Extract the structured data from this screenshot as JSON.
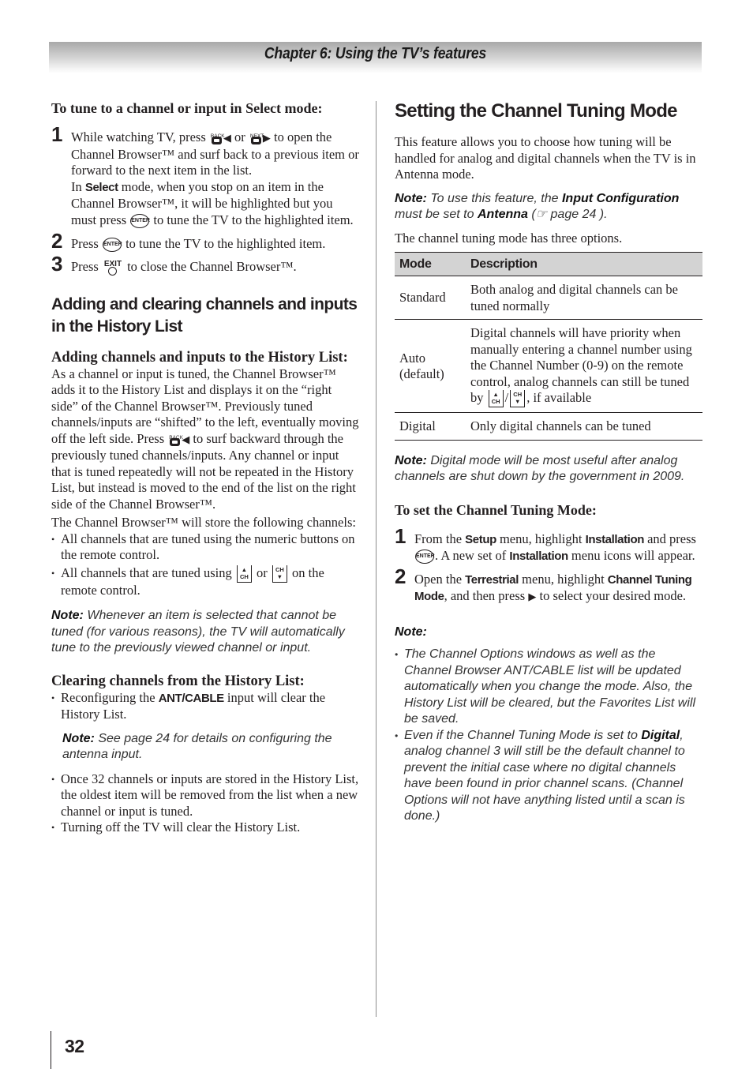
{
  "header": {
    "chapter_title": "Chapter 6: Using the TV’s features"
  },
  "page_number": "32",
  "left": {
    "select_mode": {
      "heading": "To tune to a channel or input in Select mode:",
      "step1": {
        "num": "1",
        "t1": "While watching TV, press",
        "back_label": "BACK",
        "t2": "or",
        "next_label": "NEXT",
        "t3": "to open the Channel Browser™ and surf back to a previous item or forward to the next item in the list.",
        "t4": "In",
        "kw_select": "Select",
        "t5": "mode, when you stop on an item in the Channel Browser™, it will be highlighted but you must press",
        "t6": "to tune the TV to the highlighted item."
      },
      "step2": {
        "num": "2",
        "t1": "Press",
        "t2": "to tune the TV to the highlighted item."
      },
      "step3": {
        "num": "3",
        "t1": "Press",
        "exit_label": "EXIT",
        "t2": "to close the Channel Browser™."
      }
    },
    "history": {
      "heading": "Adding and clearing channels and inputs in the History List",
      "adding_heading": "Adding channels and inputs to the History List:",
      "adding_p1a": "As a channel or input is tuned, the Channel Browser™ adds it to the History List and displays it on the “right side” of the Channel Browser™. Previously tuned channels/inputs are “shifted” to the left, eventually moving off the left side. Press",
      "adding_p1b": "to surf backward through the previously tuned channels/inputs. Any channel or input that is tuned repeatedly will not be repeated in the History List, but instead is moved to the end of the list on the right side of the Channel Browser™.",
      "adding_p2": "The Channel Browser™ will store the following channels:",
      "bullet1": "All channels that are tuned using the numeric buttons on the remote control.",
      "bullet2a": "All channels that are tuned using",
      "bullet2b": "or",
      "bullet2c": "on the remote control.",
      "note_label": "Note:",
      "note_text": "Whenever an item is selected that cannot be tuned (for various reasons), the TV will automatically tune to the previously viewed channel or input.",
      "clearing_heading": "Clearing channels from the History List:",
      "clear_b1a": "Reconfiguring the",
      "clear_b1_kw": "ANT/CABLE",
      "clear_b1b": "input will clear the History List.",
      "clear_note_label": "Note:",
      "clear_note_text": "See page 24 for details on configuring the antenna input.",
      "clear_b2": "Once 32 channels or inputs are stored in the History List, the oldest item will be removed from the list when a new channel or input is tuned.",
      "clear_b3": "Turning off the TV will clear the History List."
    }
  },
  "right": {
    "heading": "Setting the Channel Tuning Mode",
    "intro": "This feature allows you to choose how tuning will be handled for analog and digital channels when the TV is in Antenna mode.",
    "note1": {
      "label": "Note:",
      "t1": "To use this feature, the",
      "kw1": "Input Configuration",
      "t2": "must be set to",
      "kw2": "Antenna",
      "t3": "(☞ page 24 )."
    },
    "options_intro": "The channel tuning mode has three options.",
    "table": {
      "headers": [
        "Mode",
        "Description"
      ],
      "rows": [
        {
          "mode": "Standard",
          "desc": "Both analog and digital channels can be tuned normally"
        },
        {
          "mode": "Auto (default)",
          "desc": "Digital channels will have priority when manually entering a channel number using the Channel Number (0-9) on the remote control, analog channels can still be tuned by",
          "desc_suffix": ", if available",
          "sep": "/"
        },
        {
          "mode": "Digital",
          "desc": "Only digital channels can be tuned"
        }
      ]
    },
    "note2": {
      "label": "Note:",
      "text": "Digital mode will be most useful after analog channels are shut down by the government in 2009."
    },
    "set_heading": "To set the Channel Tuning Mode:",
    "step1": {
      "num": "1",
      "t1": "From the",
      "kw1": "Setup",
      "t2": "menu, highlight",
      "kw2": "Installation",
      "t3": "and press",
      "t4": ". A new set of",
      "kw3": "Installation",
      "t5": "menu icons will appear."
    },
    "step2": {
      "num": "2",
      "t1": "Open the",
      "kw1": "Terrestrial",
      "t2": "menu, highlight",
      "kw2": "Channel Tuning Mode",
      "t3": ", and then press",
      "t4": "to select your desired mode."
    },
    "note3": {
      "label": "Note:",
      "b1": "The Channel Options windows as well as the Channel Browser ANT/CABLE list will be updated automatically when you change the mode. Also, the History List will be cleared, but the Favorites List will be saved.",
      "b2a": "Even if the Channel Tuning Mode is set to",
      "b2_kw": "Digital",
      "b2b": ", analog channel 3 will still be the default channel to prevent the initial case where no digital channels have been found in prior channel scans. (Channel Options will not have anything listed until a scan is done.)"
    }
  },
  "icons": {
    "enter_label": "ENTER",
    "ch_label": "CH"
  }
}
